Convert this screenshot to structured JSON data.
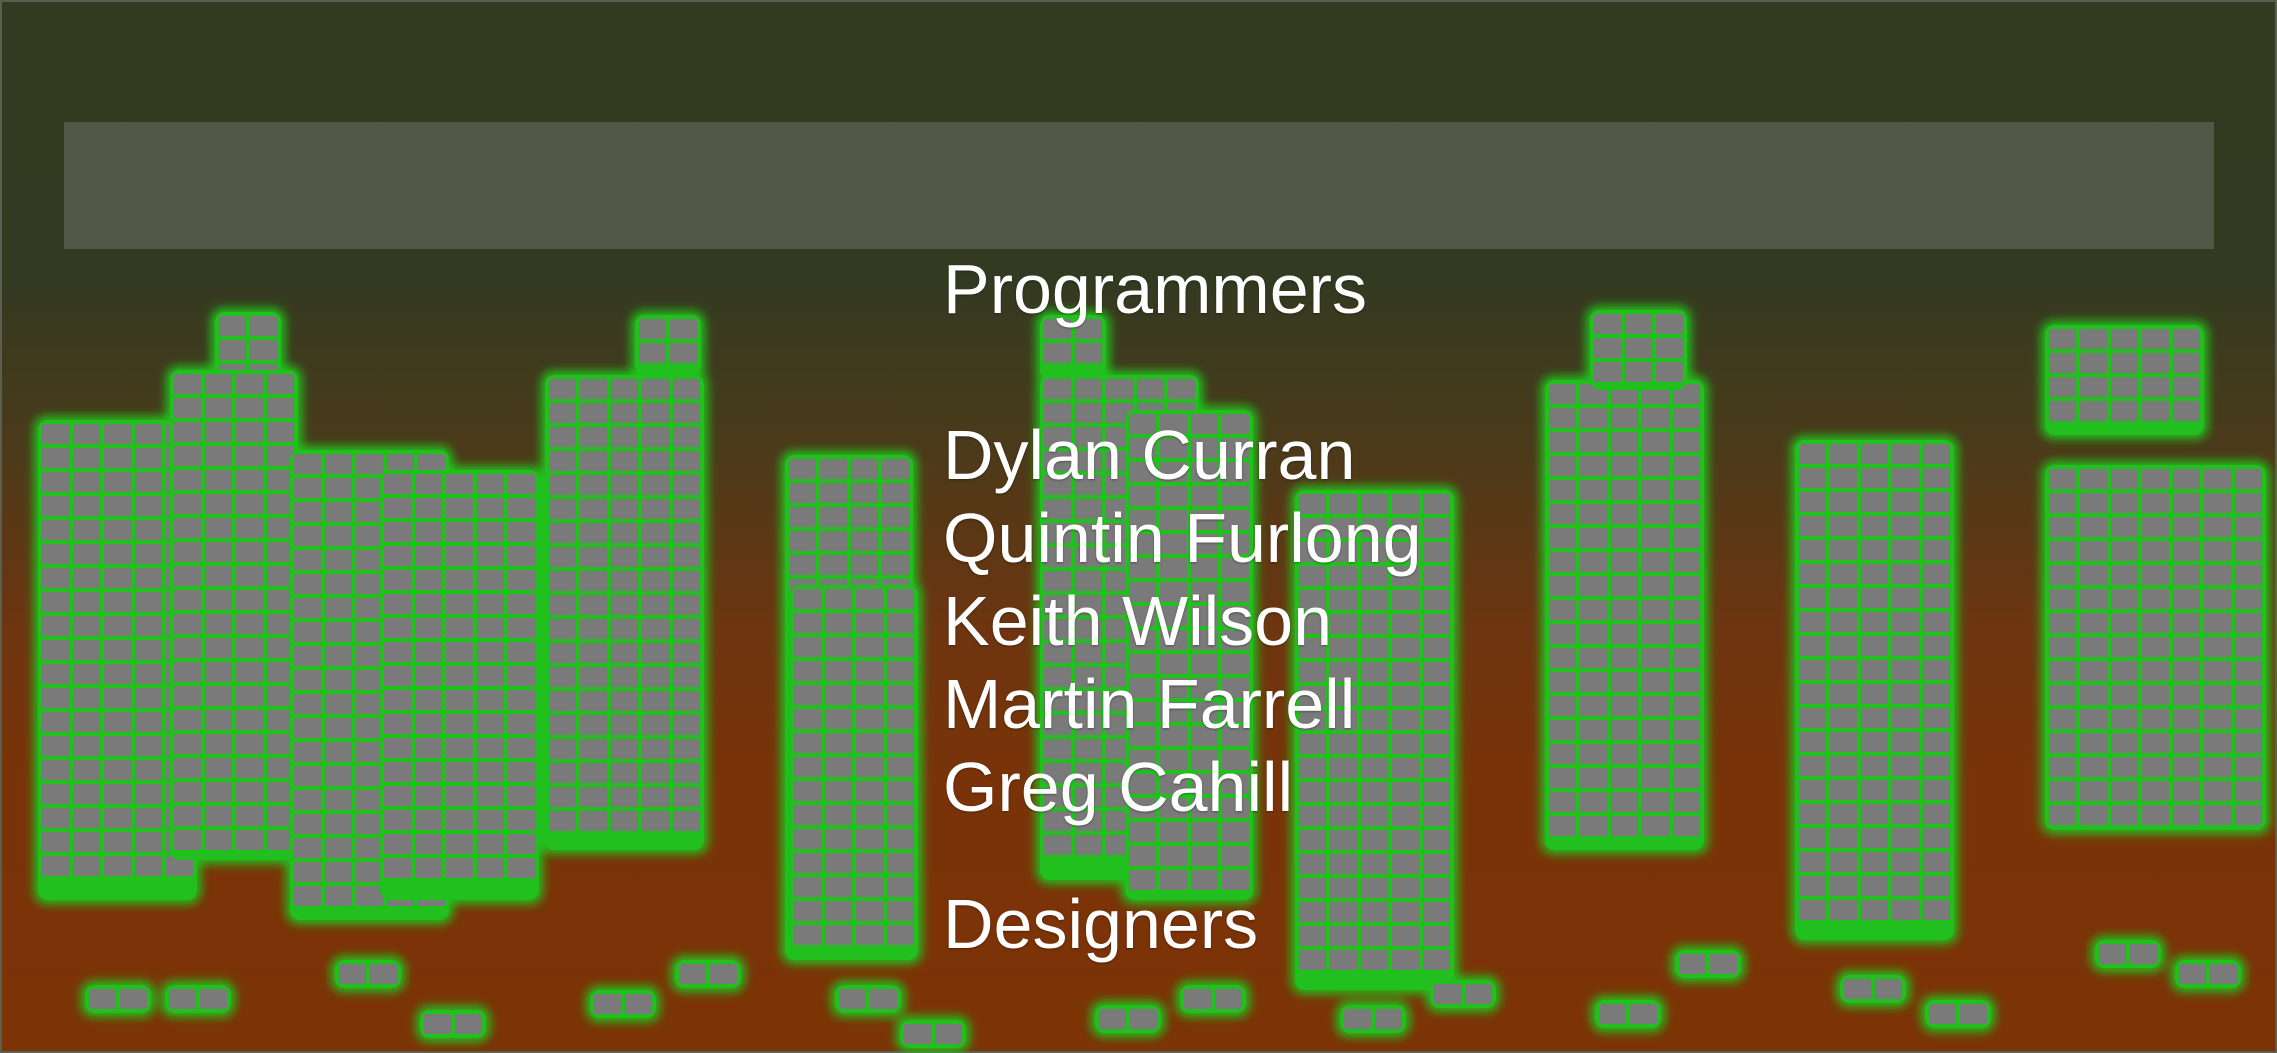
{
  "credits": {
    "programmers_heading": "Programmers",
    "programmers": [
      "Dylan Curran",
      "Quintin Furlong",
      "Keith Wilson",
      "Martin Farrell",
      "Greg Cahill"
    ],
    "designers_heading": "Designers"
  },
  "colors": {
    "sky_top": "#343a21",
    "ground": "#7c3306",
    "building_cell": "#7a7a7a",
    "building_grid": "#22c01e",
    "text": "#ffffff"
  }
}
